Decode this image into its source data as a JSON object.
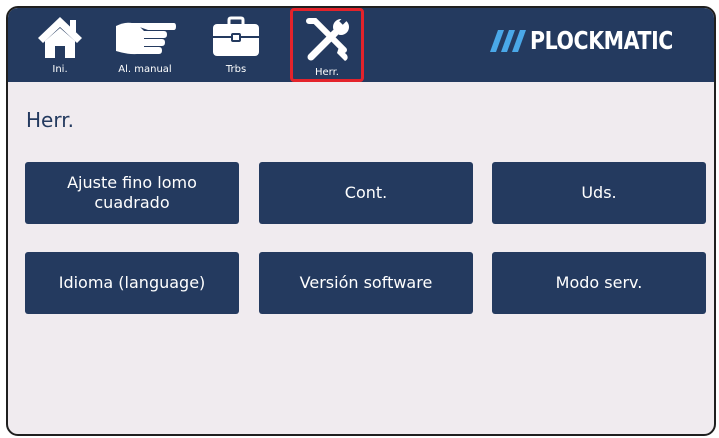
{
  "nav": {
    "items": [
      {
        "label": "Ini.",
        "icon": "home-icon"
      },
      {
        "label": "Al. manual",
        "icon": "hand-icon"
      },
      {
        "label": "Trbs",
        "icon": "briefcase-icon"
      },
      {
        "label": "Herr.",
        "icon": "tools-icon",
        "selected": true
      }
    ]
  },
  "brand": {
    "name": "PLOCKMATIC",
    "mark": "///"
  },
  "page": {
    "title": "Herr."
  },
  "tiles": [
    "Ajuste fino lomo cuadrado",
    "Cont.",
    "Uds.",
    "Idioma (language)",
    "Versión software",
    "Modo serv."
  ],
  "colors": {
    "navy": "#243a5f",
    "background": "#f0ebef",
    "selected_outline": "#e4232b"
  }
}
